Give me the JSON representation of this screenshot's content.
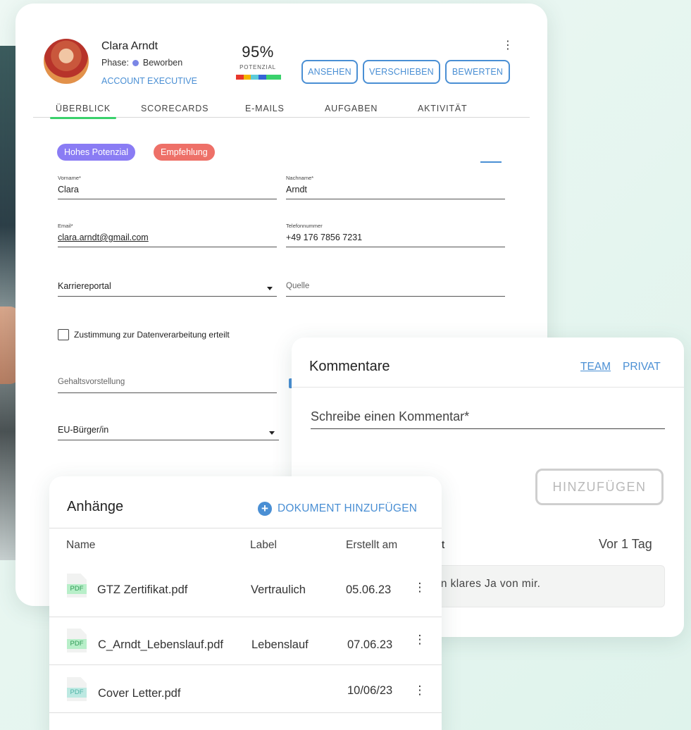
{
  "candidate": {
    "name": "Clara Arndt",
    "phase_label": "Phase:",
    "phase_value": "Beworben",
    "role": "ACCOUNT EXECUTIVE",
    "potential_pct": "95%",
    "potential_label": "POTENZIAL",
    "potential_value": 0.95,
    "potential_bar_colors": [
      "#e8372c",
      "#f4b400",
      "#5ccbd9",
      "#3465d6",
      "#3ad16c",
      "#3ad16c"
    ]
  },
  "actions": {
    "view": "ANSEHEN",
    "move": "VERSCHIEBEN",
    "rate": "BEWERTEN"
  },
  "tabs": [
    {
      "label": "ÜBERBLICK",
      "active": true
    },
    {
      "label": "SCORECARDS"
    },
    {
      "label": "E-MAILS"
    },
    {
      "label": "AUFGABEN"
    },
    {
      "label": "AKTIVITÄT"
    }
  ],
  "chips": [
    {
      "label": "Hohes Potenzial",
      "color": "#8a7cf4"
    },
    {
      "label": "Empfehlung",
      "color": "#ee7068"
    }
  ],
  "form": {
    "first_name_label": "Vorname*",
    "first_name": "Clara",
    "last_name_label": "Nachname*",
    "last_name": "Arndt",
    "email_label": "Email*",
    "email": "clara.arndt@gmail.com",
    "phone_label": "Telefonnummer",
    "phone": "+49 176 7856 7231",
    "source_type": "Karriereportal",
    "source_placeholder": "Quelle",
    "consent_label": "Zustimmung zur Datenverarbeitung erteilt",
    "salary_placeholder": "Gehaltsvorstellung",
    "citizenship": "EU-Bürger/in"
  },
  "comments": {
    "title": "Kommentare",
    "team": "TEAM",
    "private": "PRIVAT",
    "input_placeholder": "Schreibe einen Kommentar*",
    "add_button": "HINZUFÜGEN",
    "entry": {
      "author_fragment": "dt",
      "time": "Vor 1 Tag",
      "text_fragment": "in klares Ja von mir."
    }
  },
  "attachments": {
    "title": "Anhänge",
    "add_label": "DOKUMENT HINZUFÜGEN",
    "columns": [
      "Name",
      "Label",
      "Erstellt am"
    ],
    "rows": [
      {
        "name": "GTZ Zertifikat.pdf",
        "label": "Vertraulich",
        "date": "05.06.23",
        "type": "PDF"
      },
      {
        "name": "C_Arndt_Lebenslauf.pdf",
        "label": "Lebenslauf",
        "date": "07.06.23",
        "type": "PDF"
      },
      {
        "name": "Cover Letter.pdf",
        "label": "",
        "date": "10/06/23",
        "type": "PDF"
      }
    ]
  },
  "colors": {
    "accent": "#4a8fd4",
    "active_tab": "#3ad16c",
    "phase_dot": "#7a86e6"
  }
}
